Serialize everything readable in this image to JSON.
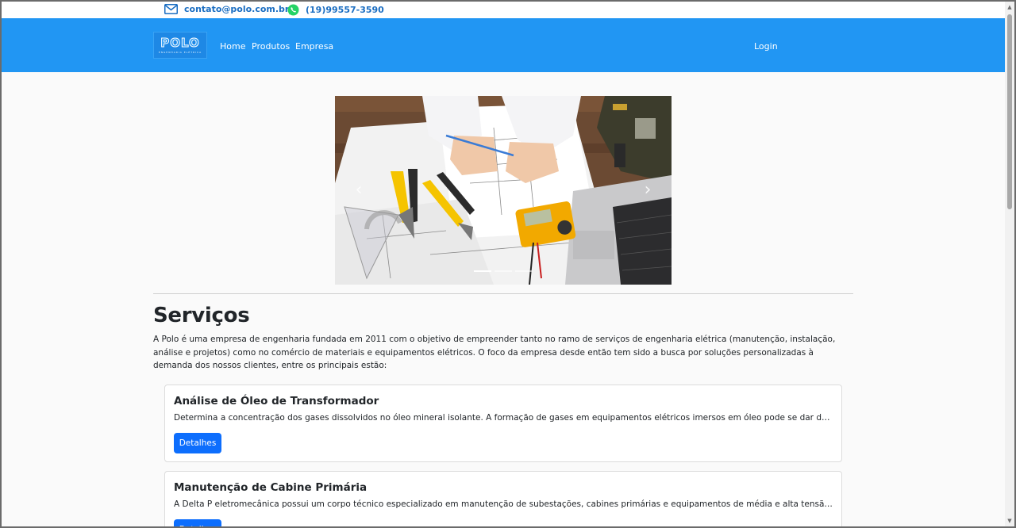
{
  "contact": {
    "email": "contato@polo.com.br",
    "phone": "(19)99557-3590",
    "email_icon": "mail-icon",
    "phone_icon": "whatsapp-icon"
  },
  "navbar": {
    "logo_text": "POLO",
    "logo_subtext": "ENGENHARIA ELÉTRICA",
    "links": [
      "Home",
      "Produtos",
      "Empresa"
    ],
    "login": "Login",
    "color": "#2196f3"
  },
  "carousel": {
    "prev_icon": "chevron-left-icon",
    "next_icon": "chevron-right-icon",
    "prev_glyph": "‹",
    "next_glyph": "›",
    "indicator_count": 3,
    "active_index": 0
  },
  "services": {
    "title": "Serviços",
    "intro": "A Polo é uma empresa de engenharia fundada em 2011 com o objetivo de empreender tanto no ramo de serviços de engenharia elétrica (manutenção, instalação, análise e projetos) como no comércio de materiais e equipamentos elétricos. O foco da empresa desde então tem sido a busca por soluções personalizadas à demanda dos nossos clientes, entre os principais estão:",
    "items": [
      {
        "title": "Análise de Óleo de Transformador",
        "description": "Determina a concentração dos gases dissolvidos no óleo mineral isolante. A formação de gases em equipamentos elétricos imersos em óleo pode se dar devido ao process...",
        "button": "Detalhes"
      },
      {
        "title": "Manutenção de Cabine Primária",
        "description": "A Delta P eletromecânica possui um corpo técnico especializado em manutenção de subestações, cabines primárias e equipamentos de média e alta tensão. Equipes comp...",
        "button": "Detalhes"
      }
    ],
    "button_color": "#0d6efd"
  }
}
